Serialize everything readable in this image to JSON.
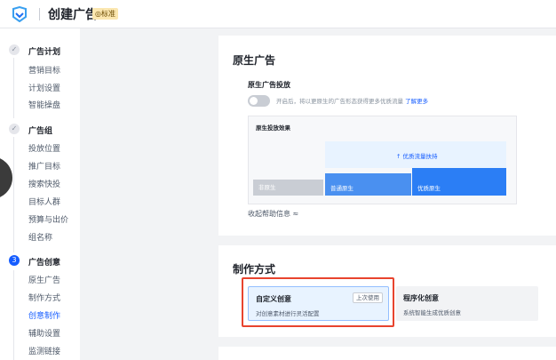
{
  "header": {
    "title": "创建广告",
    "badge": "◎标准"
  },
  "sidebar": {
    "groups": [
      {
        "step": "✓",
        "label": "广告计划",
        "items": [
          "营销目标",
          "计划设置",
          "智能操盘"
        ]
      },
      {
        "step": "✓",
        "label": "广告组",
        "items": [
          "投放位置",
          "推广目标",
          "搜索快投",
          "目标人群",
          "预算与出价",
          "组名称"
        ]
      },
      {
        "step": "3",
        "label": "广告创意",
        "items": [
          "原生广告",
          "制作方式",
          "创意制作",
          "辅助设置",
          "监测链接"
        ],
        "active_item": "创意制作"
      }
    ]
  },
  "native_ad": {
    "section_title": "原生广告",
    "toggle_label": "原生广告投放",
    "toggle_on": false,
    "tip_text": "开启后，将以更原生的广告形态获得更多优质流量",
    "learn_more": "了解更多",
    "preview": {
      "title": "原生投放效果",
      "boost_label": "↑ 优质流量扶持",
      "bars": [
        {
          "label": "非原生",
          "color": "#c9cdd4"
        },
        {
          "label": "普通原生",
          "color": "#4a90f0"
        },
        {
          "label": "优质原生",
          "color": "#2b7ef5"
        }
      ]
    },
    "collapse_text": "收起帮助信息 ≈"
  },
  "production": {
    "section_title": "制作方式",
    "options": [
      {
        "title": "自定义创意",
        "desc": "对创意素材进行灵活配置",
        "tag": "上次使用",
        "selected": true
      },
      {
        "title": "程序化创意",
        "desc": "系统智能生成优质创意",
        "selected": false
      }
    ]
  },
  "colors": {
    "primary": "#165dff",
    "highlight_border": "#e8442e"
  }
}
